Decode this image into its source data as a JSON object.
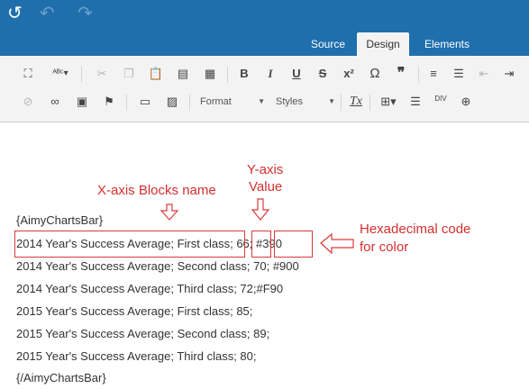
{
  "history": {
    "history_icon": "↺",
    "undo_icon": "↶",
    "redo_icon": "↷"
  },
  "tabs": [
    {
      "label": "Source",
      "active": false
    },
    {
      "label": "Design",
      "active": true
    },
    {
      "label": "Elements",
      "active": false
    }
  ],
  "toolbar": {
    "row1": {
      "maximize_icon": "⛶",
      "spellcheck_icon": "ᴬᴮᶜ▾",
      "cut_icon": "✂",
      "copy_icon": "❐",
      "paste_icon": "📋",
      "paste_text_icon": "▤",
      "paste_word_icon": "▦",
      "bold_label": "B",
      "italic_label": "I",
      "underline_label": "U",
      "strike_label": "S",
      "superscript_label": "x²",
      "special_char_label": "Ω",
      "blockquote_label": "❞",
      "numbered_list_icon": "≡",
      "bullet_list_icon": "☰",
      "outdent_icon": "⇤",
      "indent_icon": "⇥"
    },
    "row2": {
      "unlink_icon": "⊘",
      "link_icon": "∞",
      "image_icon": "▣",
      "flag_icon": "⚑",
      "template_icon": "▭",
      "picture_icon": "▨",
      "format_label": "Format",
      "styles_label": "Styles",
      "clear_format_label": "Tx",
      "table_icon": "⊞▾",
      "hr_icon": "☰",
      "div_label": "DIV",
      "globe_icon": "⊕"
    }
  },
  "content": {
    "lines": [
      "{AimyChartsBar}",
      "2014 Year's Success Average; First class; 66; #390",
      "2014 Year's Success Average; Second class; 70; #900",
      "2014 Year's Success Average; Third class; 72;#F90",
      "2015 Year's Success Average; First class; 85;",
      "2015 Year's Success Average; Second class; 89;",
      "2015 Year's Success Average; Third class; 80;",
      "{/AimyChartsBar}"
    ]
  },
  "annotations": {
    "xaxis_label": "X-axis Blocks name",
    "yaxis_line1": "Y-axis",
    "yaxis_line2": "Value",
    "hex_line1": "Hexadecimal code",
    "hex_line2": "for color"
  },
  "colors": {
    "header_blue": "#1f6fad",
    "annotation_red": "#d32f2f"
  }
}
